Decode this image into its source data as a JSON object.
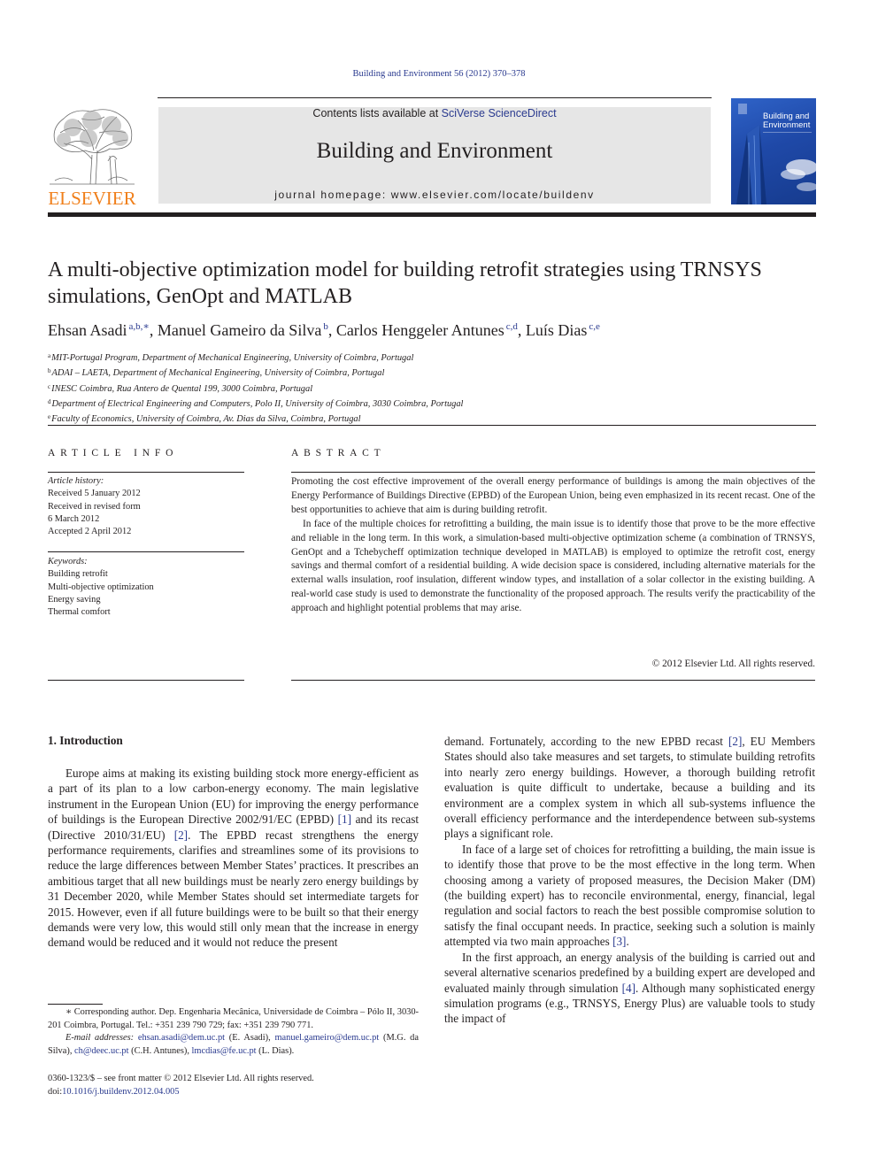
{
  "running_head": "Building and Environment 56 (2012) 370–378",
  "masthead": {
    "publisher_logo": "ELSEVIER",
    "contents_prefix": "Contents lists available at ",
    "contents_link": "SciVerse ScienceDirect",
    "journal_name": "Building and Environment",
    "homepage": "journal homepage: www.elsevier.com/locate/buildenv",
    "cover_title_line1": "Building and",
    "cover_title_line2": "Environment",
    "colors": {
      "logo_orange": "#f07f1a",
      "link_blue": "#2a3a8f",
      "banner_gray": "#e6e6e6",
      "cover_blue": "#1f49a8"
    }
  },
  "article": {
    "title": "A multi-objective optimization model for building retrofit strategies using TRNSYS simulations, GenOpt and MATLAB",
    "authors": [
      {
        "name": "Ehsan Asadi",
        "sup": "a,b,∗",
        "sep": ", "
      },
      {
        "name": "Manuel Gameiro da Silva",
        "sup": "b",
        "sep": ", "
      },
      {
        "name": "Carlos Henggeler Antunes",
        "sup": "c,d",
        "sep": ", "
      },
      {
        "name": "Luís Dias",
        "sup": "c,e",
        "sep": ""
      }
    ],
    "affiliations": [
      {
        "key": "a",
        "text": "MIT-Portugal Program, Department of Mechanical Engineering, University of Coimbra, Portugal"
      },
      {
        "key": "b",
        "text": "ADAI – LAETA, Department of Mechanical Engineering, University of Coimbra, Portugal"
      },
      {
        "key": "c",
        "text": "INESC Coimbra, Rua Antero de Quental 199, 3000 Coimbra, Portugal"
      },
      {
        "key": "d",
        "text": "Department of Electrical Engineering and Computers, Polo II, University of Coimbra, 3030 Coimbra, Portugal"
      },
      {
        "key": "e",
        "text": "Faculty of Economics, University of Coimbra, Av. Dias da Silva, Coimbra, Portugal"
      }
    ]
  },
  "article_info": {
    "heading": "ARTICLE INFO",
    "history_label": "Article history:",
    "history": [
      "Received 5 January 2012",
      "Received in revised form",
      "6 March 2012",
      "Accepted 2 April 2012"
    ],
    "keywords_label": "Keywords:",
    "keywords": [
      "Building retrofit",
      "Multi-objective optimization",
      "Energy saving",
      "Thermal comfort"
    ]
  },
  "abstract": {
    "heading": "ABSTRACT",
    "paragraphs": [
      "Promoting the cost effective improvement of the overall energy performance of buildings is among the main objectives of the Energy Performance of Buildings Directive (EPBD) of the European Union, being even emphasized in its recent recast. One of the best opportunities to achieve that aim is during building retrofit.",
      "In face of the multiple choices for retrofitting a building, the main issue is to identify those that prove to be the more effective and reliable in the long term. In this work, a simulation-based multi-objective optimization scheme (a combination of TRNSYS, GenOpt and a Tchebycheff optimization technique developed in MATLAB) is employed to optimize the retrofit cost, energy savings and thermal comfort of a residential building. A wide decision space is considered, including alternative materials for the external walls insulation, roof insulation, different window types, and installation of a solar collector in the existing building. A real-world case study is used to demonstrate the functionality of the proposed approach. The results verify the practicability of the approach and highlight potential problems that may arise."
    ],
    "copyright": "© 2012 Elsevier Ltd. All rights reserved."
  },
  "body": {
    "section_heading": "1.  Introduction",
    "left_paragraph": [
      {
        "t": "Europe aims at making its existing building stock more energy-efficient as a part of its plan to a low carbon-energy economy. The main legislative instrument in the European Union (EU) for improving the energy performance of buildings is the European Directive 2002/91/EC (EPBD) "
      },
      {
        "ref": "[1]"
      },
      {
        "t": " and its recast (Directive 2010/31/EU) "
      },
      {
        "ref": "[2]"
      },
      {
        "t": ". The EPBD recast strengthens the energy performance requirements, clarifies and streamlines some of its provisions to reduce the large differences between Member States’ practices. It prescribes an ambitious target that all new buildings must be nearly zero energy buildings by 31 December 2020, while Member States should set intermediate targets for 2015. However, even if all future buildings were to be built so that their energy demands were very low, this would still only mean that the increase in energy demand would be reduced and it would not reduce the present"
      }
    ],
    "right_paragraphs": [
      [
        {
          "t": "demand. Fortunately, according to the new EPBD recast "
        },
        {
          "ref": "[2]"
        },
        {
          "t": ", EU Members States should also take measures and set targets, to stimulate building retrofits into nearly zero energy buildings. However, a thorough building retrofit evaluation is quite difficult to undertake, because a building and its environment are a complex system in which all sub-systems influence the overall efficiency performance and the interdependence between sub-systems plays a significant role."
        }
      ],
      [
        {
          "t": "In face of a large set of choices for retrofitting a building, the main issue is to identify those that prove to be the most effective in the long term. When choosing among a variety of proposed measures, the Decision Maker (DM) (the building expert) has to reconcile environmental, energy, financial, legal regulation and social factors to reach the best possible compromise solution to satisfy the final occupant needs. In practice, seeking such a solution is mainly attempted via two main approaches "
        },
        {
          "ref": "[3]"
        },
        {
          "t": "."
        }
      ],
      [
        {
          "t": "In the first approach, an energy analysis of the building is carried out and several alternative scenarios predefined by a building expert are developed and evaluated mainly through simulation "
        },
        {
          "ref": "[4]"
        },
        {
          "t": ". Although many sophisticated energy simulation programs (e.g., TRNSYS, Energy Plus) are valuable tools to study the impact of"
        }
      ]
    ]
  },
  "footnotes": {
    "corresponding": "∗ Corresponding author. Dep. Engenharia Mecânica, Universidade de Coimbra – Pólo II, 3030-201 Coimbra, Portugal. Tel.: +351 239 790 729; fax: +351 239 790 771.",
    "email_label": "E-mail addresses:",
    "emails": [
      {
        "email": "ehsan.asadi@dem.uc.pt",
        "who": " (E. Asadi), "
      },
      {
        "email": "manuel.gameiro@dem.uc.pt",
        "who": " (M.G. da Silva), "
      },
      {
        "email": "ch@deec.uc.pt",
        "who": " (C.H. Antunes), "
      },
      {
        "email": "lmcdias@fe.uc.pt",
        "who": " (L. Dias)."
      }
    ]
  },
  "front_matter": {
    "issn_line": "0360-1323/$ – see front matter © 2012 Elsevier Ltd. All rights reserved.",
    "doi_prefix": "doi:",
    "doi": "10.1016/j.buildenv.2012.04.005"
  }
}
